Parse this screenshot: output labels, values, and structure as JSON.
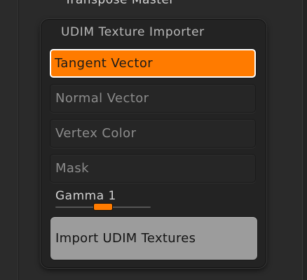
{
  "previous_panel": {
    "title": "Transpose Master"
  },
  "panel": {
    "title": "UDIM Texture Importer",
    "options": [
      {
        "label": "Tangent Vector",
        "active": true
      },
      {
        "label": "Normal Vector",
        "active": false
      },
      {
        "label": "Vertex Color",
        "active": false
      },
      {
        "label": "Mask",
        "active": false
      }
    ],
    "gamma": {
      "label": "Gamma 1",
      "value": 1
    },
    "import_label": "Import UDIM Textures"
  },
  "colors": {
    "accent": "#ff7b00",
    "panel_bg": "#232323",
    "page_bg": "#2a2a2a",
    "import_button_bg": "#9c9c9c"
  }
}
